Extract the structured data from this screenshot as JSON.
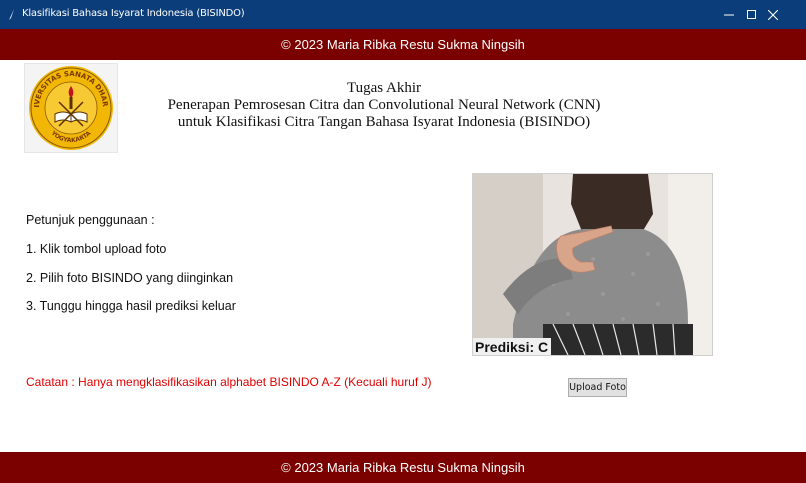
{
  "window": {
    "title": "Klasifikasi Bahasa Isyarat Indonesia (BISINDO)",
    "controls": [
      "minimize",
      "maximize",
      "close"
    ]
  },
  "banner": {
    "copyright": "© 2023 Maria Ribka Restu Sukma Ningsih"
  },
  "header": {
    "line1": "Tugas Akhir",
    "line2": "Penerapan Pemrosesan Citra dan Convolutional Neural Network (CNN)",
    "line3": "untuk Klasifikasi Citra Tangan Bahasa Isyarat Indonesia (BISINDO)"
  },
  "logo": {
    "text_top": "UNIVERSITAS SANATA DHARMA",
    "text_bottom": "YOGYAKARTA",
    "colors": {
      "gold": "#f2b705",
      "red": "#c0161c"
    }
  },
  "instructions": {
    "heading": "Petunjuk penggunaan :",
    "steps": [
      "1. Klik tombol upload foto",
      "2. Pilih foto BISINDO yang diinginkan",
      "3. Tunggu hingga hasil prediksi keluar"
    ]
  },
  "note": "Catatan : Hanya mengklasifikasikan alphabet BISINDO A-Z (Kecuali huruf J)",
  "result": {
    "prediction_text": "Prediksi: C"
  },
  "upload_button": {
    "label": "Upload Foto"
  },
  "colors": {
    "titlebar": "#0a3d7a",
    "banner": "#7b0000",
    "note": "#e00000"
  }
}
